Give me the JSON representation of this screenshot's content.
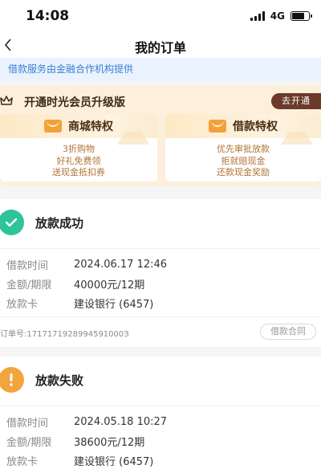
{
  "status_bar": {
    "time": "14:08",
    "network": "4G",
    "battery_level": 0.75
  },
  "nav": {
    "title": "我的订单"
  },
  "notice": {
    "text": "借款服务由金融合作机构提供"
  },
  "vip": {
    "title": "开通时光会员升级版",
    "button": "去开通",
    "cards": [
      {
        "title": "商城特权",
        "lines": [
          "3折购物",
          "好礼免费领",
          "送现金抵扣券"
        ]
      },
      {
        "title": "借款特权",
        "lines": [
          "优先审批放款",
          "拒就赔现金",
          "还款现金奖励"
        ]
      }
    ]
  },
  "orders": [
    {
      "status": "放款成功",
      "status_icon": "check-icon",
      "fields": [
        {
          "label": "借款时间",
          "value": "2024.06.17 12:46"
        },
        {
          "label": "金额/期限",
          "value": "40000元/12期"
        },
        {
          "label": "放款卡",
          "value": "建设银行 (6457)"
        }
      ],
      "order_no": "订单号:1717171928994591000З",
      "contract": "借款合同"
    },
    {
      "status": "放款失败",
      "status_icon": "exclamation-icon",
      "fields": [
        {
          "label": "借款时间",
          "value": "2024.05.18 10:27"
        },
        {
          "label": "金额/期限",
          "value": "38600元/12期"
        },
        {
          "label": "放款卡",
          "value": "建设银行 (6457)"
        }
      ]
    }
  ],
  "colors": {
    "success": "#2fc39a",
    "fail": "#f2a43d",
    "notice_text": "#3a7fd4",
    "vip_button": "#6b3a2a"
  }
}
